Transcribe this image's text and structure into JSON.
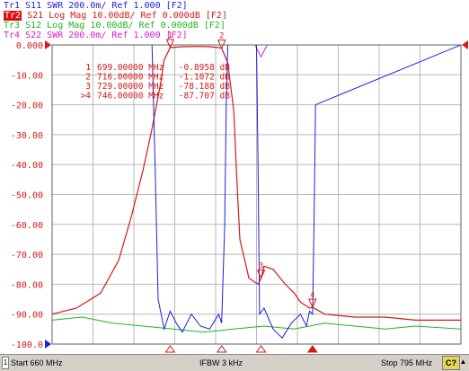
{
  "traces": [
    {
      "id": "Tr1",
      "param": "S11",
      "format": "SWR",
      "scale": "200.0m/",
      "ref": "Ref 1.000",
      "tag": "[F2]",
      "color": "#1f1fd8",
      "active": false
    },
    {
      "id": "Tr2",
      "param": "S21",
      "format": "Log Mag",
      "scale": "10.00dB/",
      "ref": "Ref 0.000dB",
      "tag": "[F2]",
      "color": "#d01a1a",
      "active": true
    },
    {
      "id": "Tr3",
      "param": "S12",
      "format": "Log Mag",
      "scale": "10.00dB/",
      "ref": "Ref 0.000dB",
      "tag": "[F2]",
      "color": "#22b422",
      "active": false
    },
    {
      "id": "Tr4",
      "param": "S22",
      "format": "SWR",
      "scale": "200.0m/",
      "ref": "Ref 1.000",
      "tag": "[F2]",
      "color": "#d21ed2",
      "active": false
    }
  ],
  "markers": [
    {
      "label": "1",
      "freq": "699.00000 MHz",
      "value": "-0.8958 dB"
    },
    {
      "label": "2",
      "freq": "716.00000 MHz",
      "value": "-1.1072 dB"
    },
    {
      "label": "3",
      "freq": "729.00000 MHz",
      "value": "-78.188 dB"
    },
    {
      "label": ">4",
      "freq": "746.00000 MHz",
      "value": "-87.707 dB"
    }
  ],
  "status": {
    "channel": "1",
    "start": "Start 660 MHz",
    "ifbw": "IFBW 3 kHz",
    "stop": "Stop 795 MHz",
    "c_badge": "C?",
    "arrow": "▲"
  },
  "colors": {
    "grid": "#b8b8b8",
    "axis_label": "#d01a1a",
    "s11": "#1f1fd8",
    "s21": "#d01a1a",
    "s12": "#22b422",
    "s22": "#d21ed2",
    "marker": "#d01a1a",
    "ref_arrow": "#e01818"
  },
  "chart_data": {
    "type": "line",
    "x_range_mhz": [
      660,
      795
    ],
    "ylim": [
      -100,
      0
    ],
    "y_ticks": [
      "0.000",
      "-10.00",
      "-20.00",
      "-30.00",
      "-40.00",
      "-50.00",
      "-60.00",
      "-70.00",
      "-80.00",
      "-90.00",
      "-100.0"
    ],
    "grid": true,
    "marker_positions_mhz": [
      699,
      716,
      729,
      746
    ],
    "series": [
      {
        "name": "S21",
        "x": [
          660,
          668,
          676,
          682,
          686,
          690,
          693,
          696,
          697,
          699,
          703,
          708,
          712,
          715,
          716,
          718,
          720,
          721,
          722,
          725,
          728,
          729,
          730,
          733,
          737,
          740,
          742,
          745,
          746,
          750,
          760,
          770,
          780,
          795
        ],
        "y": [
          -90,
          -88,
          -83,
          -72,
          -58,
          -42,
          -28,
          -12,
          -5,
          -0.9,
          -0.6,
          -0.5,
          -0.6,
          -0.9,
          -1.1,
          -6,
          -22,
          -45,
          -65,
          -78,
          -80,
          -78,
          -74,
          -75,
          -80,
          -83,
          -86,
          -88,
          -87.7,
          -90,
          -91,
          -91,
          -92,
          -92
        ]
      },
      {
        "name": "S11",
        "x": [
          660,
          693,
          694,
          695,
          697,
          699,
          701,
          703,
          706,
          709,
          712,
          715,
          716,
          717,
          717.5,
          718,
          727.5,
          728,
          728.5,
          730,
          733,
          736,
          739,
          742,
          744,
          745,
          746,
          746.5,
          747,
          795
        ],
        "y": [
          0,
          0,
          -40,
          -85,
          -95,
          -89,
          -93,
          -96,
          -90,
          -94,
          -95,
          -90,
          -93,
          -60,
          -20,
          0,
          0,
          -40,
          -90,
          -88,
          -95,
          -98,
          -93,
          -90,
          -94,
          -89,
          -90,
          -60,
          -20,
          0
        ]
      },
      {
        "name": "S22",
        "x": [
          660,
          700,
          710,
          720,
          727,
          729,
          731,
          740,
          746,
          750,
          795
        ],
        "y": [
          0,
          0,
          0,
          0,
          0,
          -4,
          0,
          0,
          0,
          0,
          0
        ]
      },
      {
        "name": "S12",
        "x": [
          660,
          670,
          680,
          690,
          700,
          710,
          720,
          730,
          740,
          750,
          760,
          770,
          780,
          795
        ],
        "y": [
          -92,
          -91,
          -93,
          -94,
          -95,
          -96,
          -95,
          -94,
          -95,
          -93,
          -94,
          -95,
          -94,
          -95
        ]
      }
    ]
  }
}
